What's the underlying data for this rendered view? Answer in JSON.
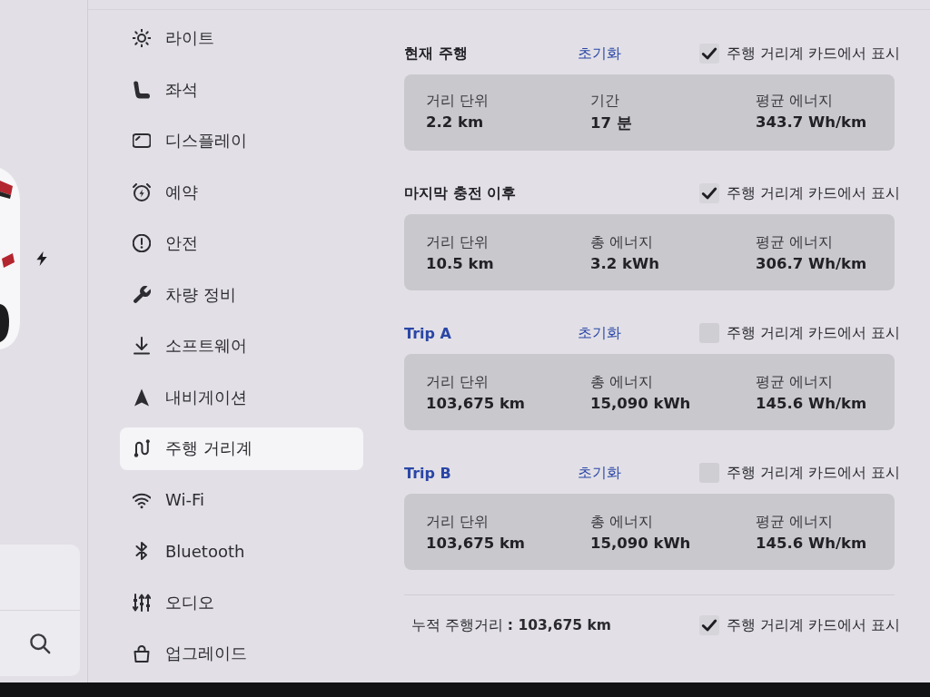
{
  "sidebar": {
    "items": [
      {
        "label": "라이트",
        "selected": false
      },
      {
        "label": "좌석",
        "selected": false
      },
      {
        "label": "디스플레이",
        "selected": false
      },
      {
        "label": "예약",
        "selected": false
      },
      {
        "label": "안전",
        "selected": false
      },
      {
        "label": "차량 정비",
        "selected": false
      },
      {
        "label": "소프트웨어",
        "selected": false
      },
      {
        "label": "내비게이션",
        "selected": false
      },
      {
        "label": "주행 거리계",
        "selected": true
      },
      {
        "label": "Wi-Fi",
        "selected": false
      },
      {
        "label": "Bluetooth",
        "selected": false
      },
      {
        "label": "오디오",
        "selected": false
      },
      {
        "label": "업그레이드",
        "selected": false
      }
    ]
  },
  "sections": [
    {
      "kind": "summary",
      "title": "현재 주행",
      "reset": "초기화",
      "show_on_card": {
        "label": "주행 거리계 카드에서 표시",
        "checked": true
      },
      "stats": [
        {
          "label": "거리 단위",
          "value": "2.2 km"
        },
        {
          "label": "기간",
          "value": "17 분"
        },
        {
          "label": "평균 에너지",
          "value": "343.7 Wh/km"
        }
      ]
    },
    {
      "kind": "summary",
      "title": "마지막 충전 이후",
      "show_on_card": {
        "label": "주행 거리계 카드에서 표시",
        "checked": true
      },
      "stats": [
        {
          "label": "거리 단위",
          "value": "10.5 km"
        },
        {
          "label": "총 에너지",
          "value": "3.2 kWh"
        },
        {
          "label": "평균 에너지",
          "value": "306.7 Wh/km"
        }
      ]
    },
    {
      "kind": "trip",
      "title": "Trip A",
      "reset": "초기화",
      "show_on_card": {
        "label": "주행 거리계 카드에서 표시",
        "checked": false
      },
      "stats": [
        {
          "label": "거리 단위",
          "value": "103,675 km"
        },
        {
          "label": "총 에너지",
          "value": "15,090 kWh"
        },
        {
          "label": "평균 에너지",
          "value": "145.6 Wh/km"
        }
      ]
    },
    {
      "kind": "trip",
      "title": "Trip B",
      "reset": "초기화",
      "show_on_card": {
        "label": "주행 거리계 카드에서 표시",
        "checked": false
      },
      "stats": [
        {
          "label": "거리 단위",
          "value": "103,675 km"
        },
        {
          "label": "총 에너지",
          "value": "15,090 kWh"
        },
        {
          "label": "평균 에너지",
          "value": "145.6 Wh/km"
        }
      ]
    }
  ],
  "odometer": {
    "text": "누적 주행거리 **: 103,675 km**",
    "show_on_card": {
      "label": "주행 거리계 카드에서 표시",
      "checked": true
    }
  }
}
